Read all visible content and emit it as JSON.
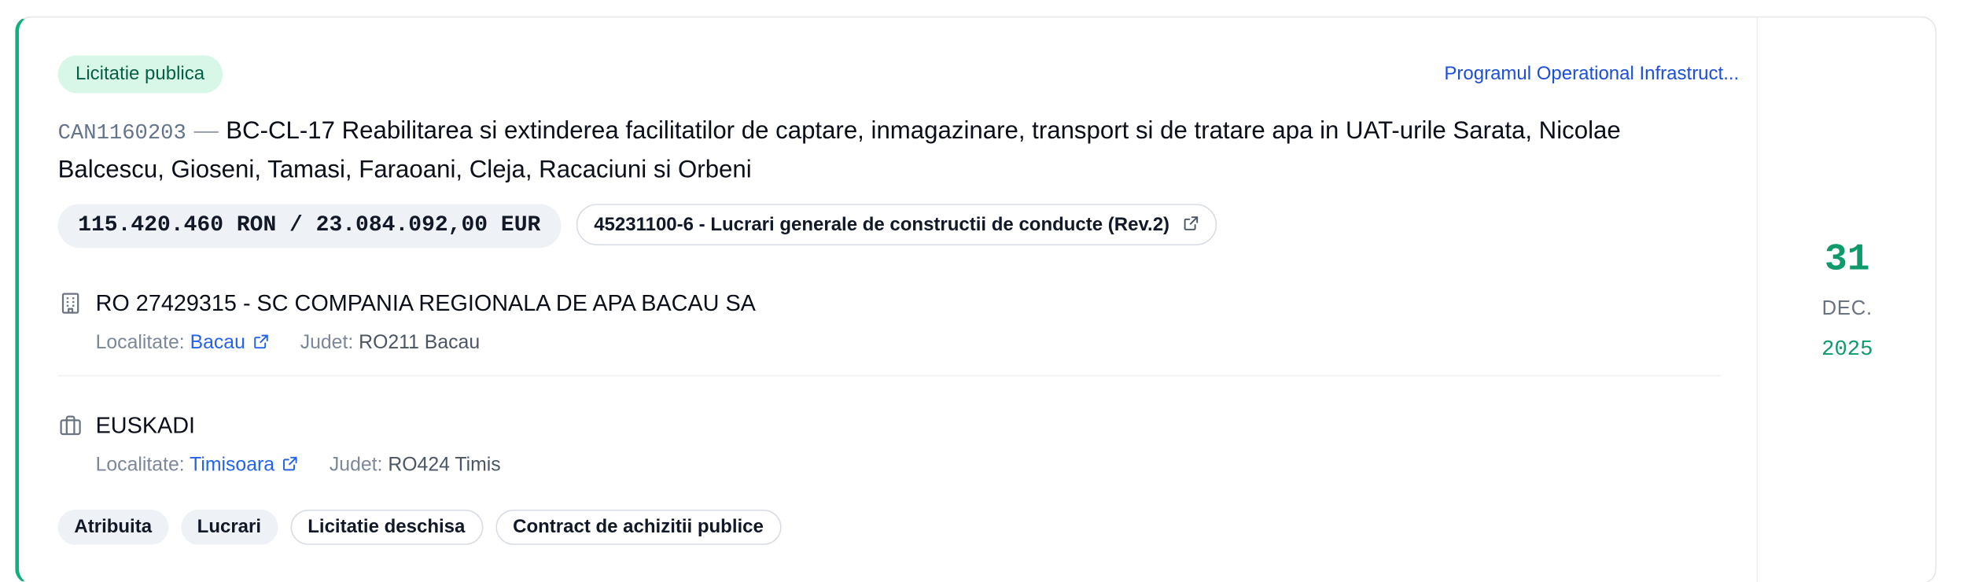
{
  "notice": {
    "type_badge": "Licitatie publica",
    "program_link": "Programul Operational Infrastruct...",
    "code": "CAN1160203",
    "title": "BC-CL-17 Reabilitarea si extinderea facilitatilor de captare, inmagazinare, transport si de tratare apa in UAT-urile Sarata, Nicolae Balcescu, Gioseni, Tamasi, Faraoani, Cleja, Racaciuni si Orbeni",
    "value": "115.420.460 RON / 23.084.092,00 EUR",
    "cpv": "45231100-6 - Lucrari generale de constructii de conducte (Rev.2)"
  },
  "authority": {
    "name": "RO 27429315 - SC COMPANIA REGIONALA DE APA BACAU SA",
    "locality_label": "Localitate:",
    "locality": "Bacau",
    "county_label": "Judet:",
    "county": "RO211 Bacau",
    "icon": "building-icon"
  },
  "winner": {
    "name": "EUSKADI",
    "locality_label": "Localitate:",
    "locality": "Timisoara",
    "county_label": "Judet:",
    "county": "RO424 Timis",
    "icon": "briefcase-icon"
  },
  "tags": [
    {
      "label": "Atribuita",
      "style": "filled"
    },
    {
      "label": "Lucrari",
      "style": "filled"
    },
    {
      "label": "Licitatie deschisa",
      "style": "outline"
    },
    {
      "label": "Contract de achizitii publice",
      "style": "outline"
    }
  ],
  "date": {
    "day": "31",
    "month": "DEC.",
    "year": "2025"
  },
  "colors": {
    "accent": "#10b07c",
    "link": "#2563eb",
    "badge_bg": "#d9f7e8",
    "date_green": "#0f9a6b"
  }
}
